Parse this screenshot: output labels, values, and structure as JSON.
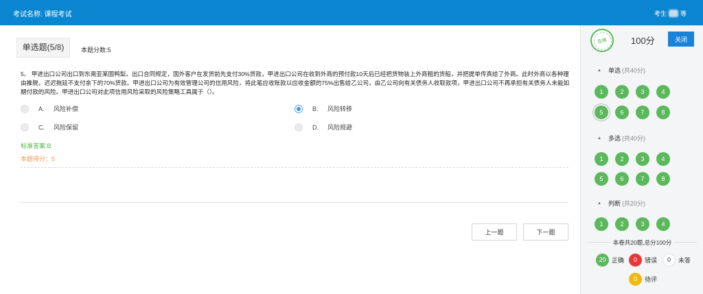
{
  "header": {
    "exam_title": "考试名称: 课程考试",
    "student_label": "考生",
    "student_name_tail": "等"
  },
  "question": {
    "type_label": "单选题(5/8)",
    "score_label": "本题分数:5",
    "text": "5、 甲进出口公司出口到东南亚某国鸭梨。出口合同规定，国外客户在发货前先支付30%货款，甲进出口公司在收到外商的预付款10天后已经把货物装上外商租的货船，并把提单传真给了外商。此时外商以各种理由推脱，迟迟拖延不支付余下的70%货款。甲进出口公司为有效管理公司的信用风险，将此笔应收账款以应收金额的75%出售给乙公司，由乙公司向有关债务人收取款项，甲进出口公司不再承担有关债务人未能如期付款的风险。甲进出口公司对此项信用风险采取的风险策略工具属于（）。",
    "options": [
      {
        "letter": "A.",
        "text": "风险补偿",
        "checked": false
      },
      {
        "letter": "B.",
        "text": "风险转移",
        "checked": true
      },
      {
        "letter": "C.",
        "text": "风险保留",
        "checked": false
      },
      {
        "letter": "D.",
        "text": "风险规避",
        "checked": false
      }
    ],
    "standard_answer": "标准答案:B",
    "earned_score": "本题得分：5"
  },
  "nav": {
    "prev_label": "上一题",
    "next_label": "下一题"
  },
  "side": {
    "stamp_text": "及格",
    "total_score": "100分",
    "close_label": "关闭",
    "sections": [
      {
        "name": "单选",
        "sub": "(共40分)",
        "numbers": [
          "1",
          "2",
          "3",
          "4",
          "5",
          "6",
          "7",
          "8"
        ],
        "current": "5"
      },
      {
        "name": "多选",
        "sub": "(共40分)",
        "numbers": [
          "1",
          "2",
          "3",
          "4",
          "5",
          "6",
          "7",
          "8"
        ],
        "current": ""
      },
      {
        "name": "判断",
        "sub": "(共20分)",
        "numbers": [
          "1",
          "2",
          "3",
          "4"
        ],
        "current": ""
      }
    ],
    "summary": "本卷共20题,总分100分",
    "legend": [
      {
        "count": "20",
        "label": "正确",
        "color": "#5cb85c"
      },
      {
        "count": "0",
        "label": "错误",
        "color": "#e53935"
      },
      {
        "count": "0",
        "label": "未答",
        "color": "#ffffff"
      },
      {
        "count": "0",
        "label": "待评",
        "color": "#f0b912"
      }
    ]
  }
}
